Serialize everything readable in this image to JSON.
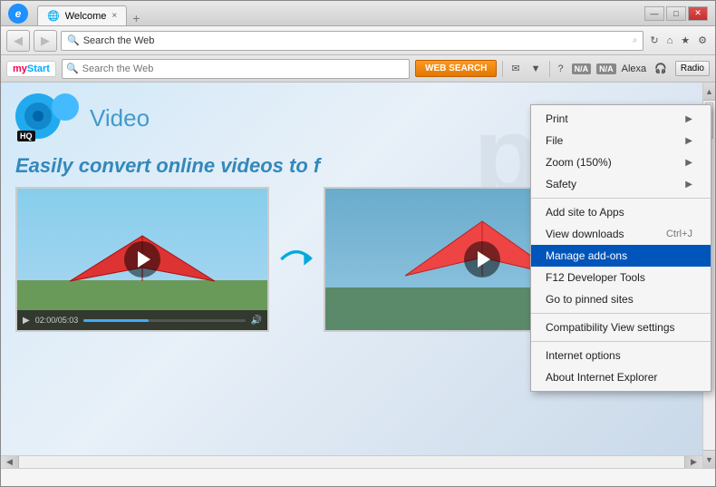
{
  "window": {
    "title": "Welcome",
    "tab_label": "Welcome",
    "tab_close": "×"
  },
  "window_controls": {
    "minimize": "—",
    "maximize": "□",
    "close": "✕"
  },
  "nav": {
    "back": "◀",
    "forward": "▶",
    "address": "Search the Web",
    "refresh": "↻",
    "search_placeholder": "⌕"
  },
  "toolbar": {
    "mystart_my": "my",
    "mystart_start": "Start",
    "search_placeholder": "Search the Web",
    "web_search_btn": "WEB SEARCH",
    "na_badge1": "N/A",
    "na_badge2": "N/A",
    "alexa_label": "Alexa",
    "radio_btn": "Radio"
  },
  "webpage": {
    "watermark": "pv7",
    "camera_hq": "HQ",
    "video_label": "Video",
    "tagline": "Easily convert online videos to f",
    "time": "02:00/05:03"
  },
  "context_menu": {
    "items": [
      {
        "id": "print",
        "label": "Print",
        "shortcut": "",
        "arrow": "▶",
        "has_arrow": true,
        "highlighted": false
      },
      {
        "id": "file",
        "label": "File",
        "shortcut": "",
        "arrow": "▶",
        "has_arrow": true,
        "highlighted": false
      },
      {
        "id": "zoom",
        "label": "Zoom (150%)",
        "shortcut": "",
        "arrow": "▶",
        "has_arrow": true,
        "highlighted": false
      },
      {
        "id": "safety",
        "label": "Safety",
        "shortcut": "",
        "arrow": "▶",
        "has_arrow": true,
        "highlighted": false
      },
      {
        "id": "sep1",
        "type": "separator"
      },
      {
        "id": "add_site",
        "label": "Add site to Apps",
        "shortcut": "",
        "highlighted": false
      },
      {
        "id": "view_downloads",
        "label": "View downloads",
        "shortcut": "Ctrl+J",
        "highlighted": false
      },
      {
        "id": "manage_addons",
        "label": "Manage add-ons",
        "shortcut": "",
        "highlighted": true
      },
      {
        "id": "f12_tools",
        "label": "F12 Developer Tools",
        "shortcut": "",
        "highlighted": false
      },
      {
        "id": "go_pinned",
        "label": "Go to pinned sites",
        "shortcut": "",
        "highlighted": false
      },
      {
        "id": "sep2",
        "type": "separator"
      },
      {
        "id": "compat_view",
        "label": "Compatibility View settings",
        "shortcut": "",
        "highlighted": false
      },
      {
        "id": "sep3",
        "type": "separator"
      },
      {
        "id": "internet_options",
        "label": "Internet options",
        "shortcut": "",
        "highlighted": false
      },
      {
        "id": "about_ie",
        "label": "About Internet Explorer",
        "shortcut": "",
        "highlighted": false
      }
    ]
  },
  "status_bar": {
    "text": ""
  }
}
